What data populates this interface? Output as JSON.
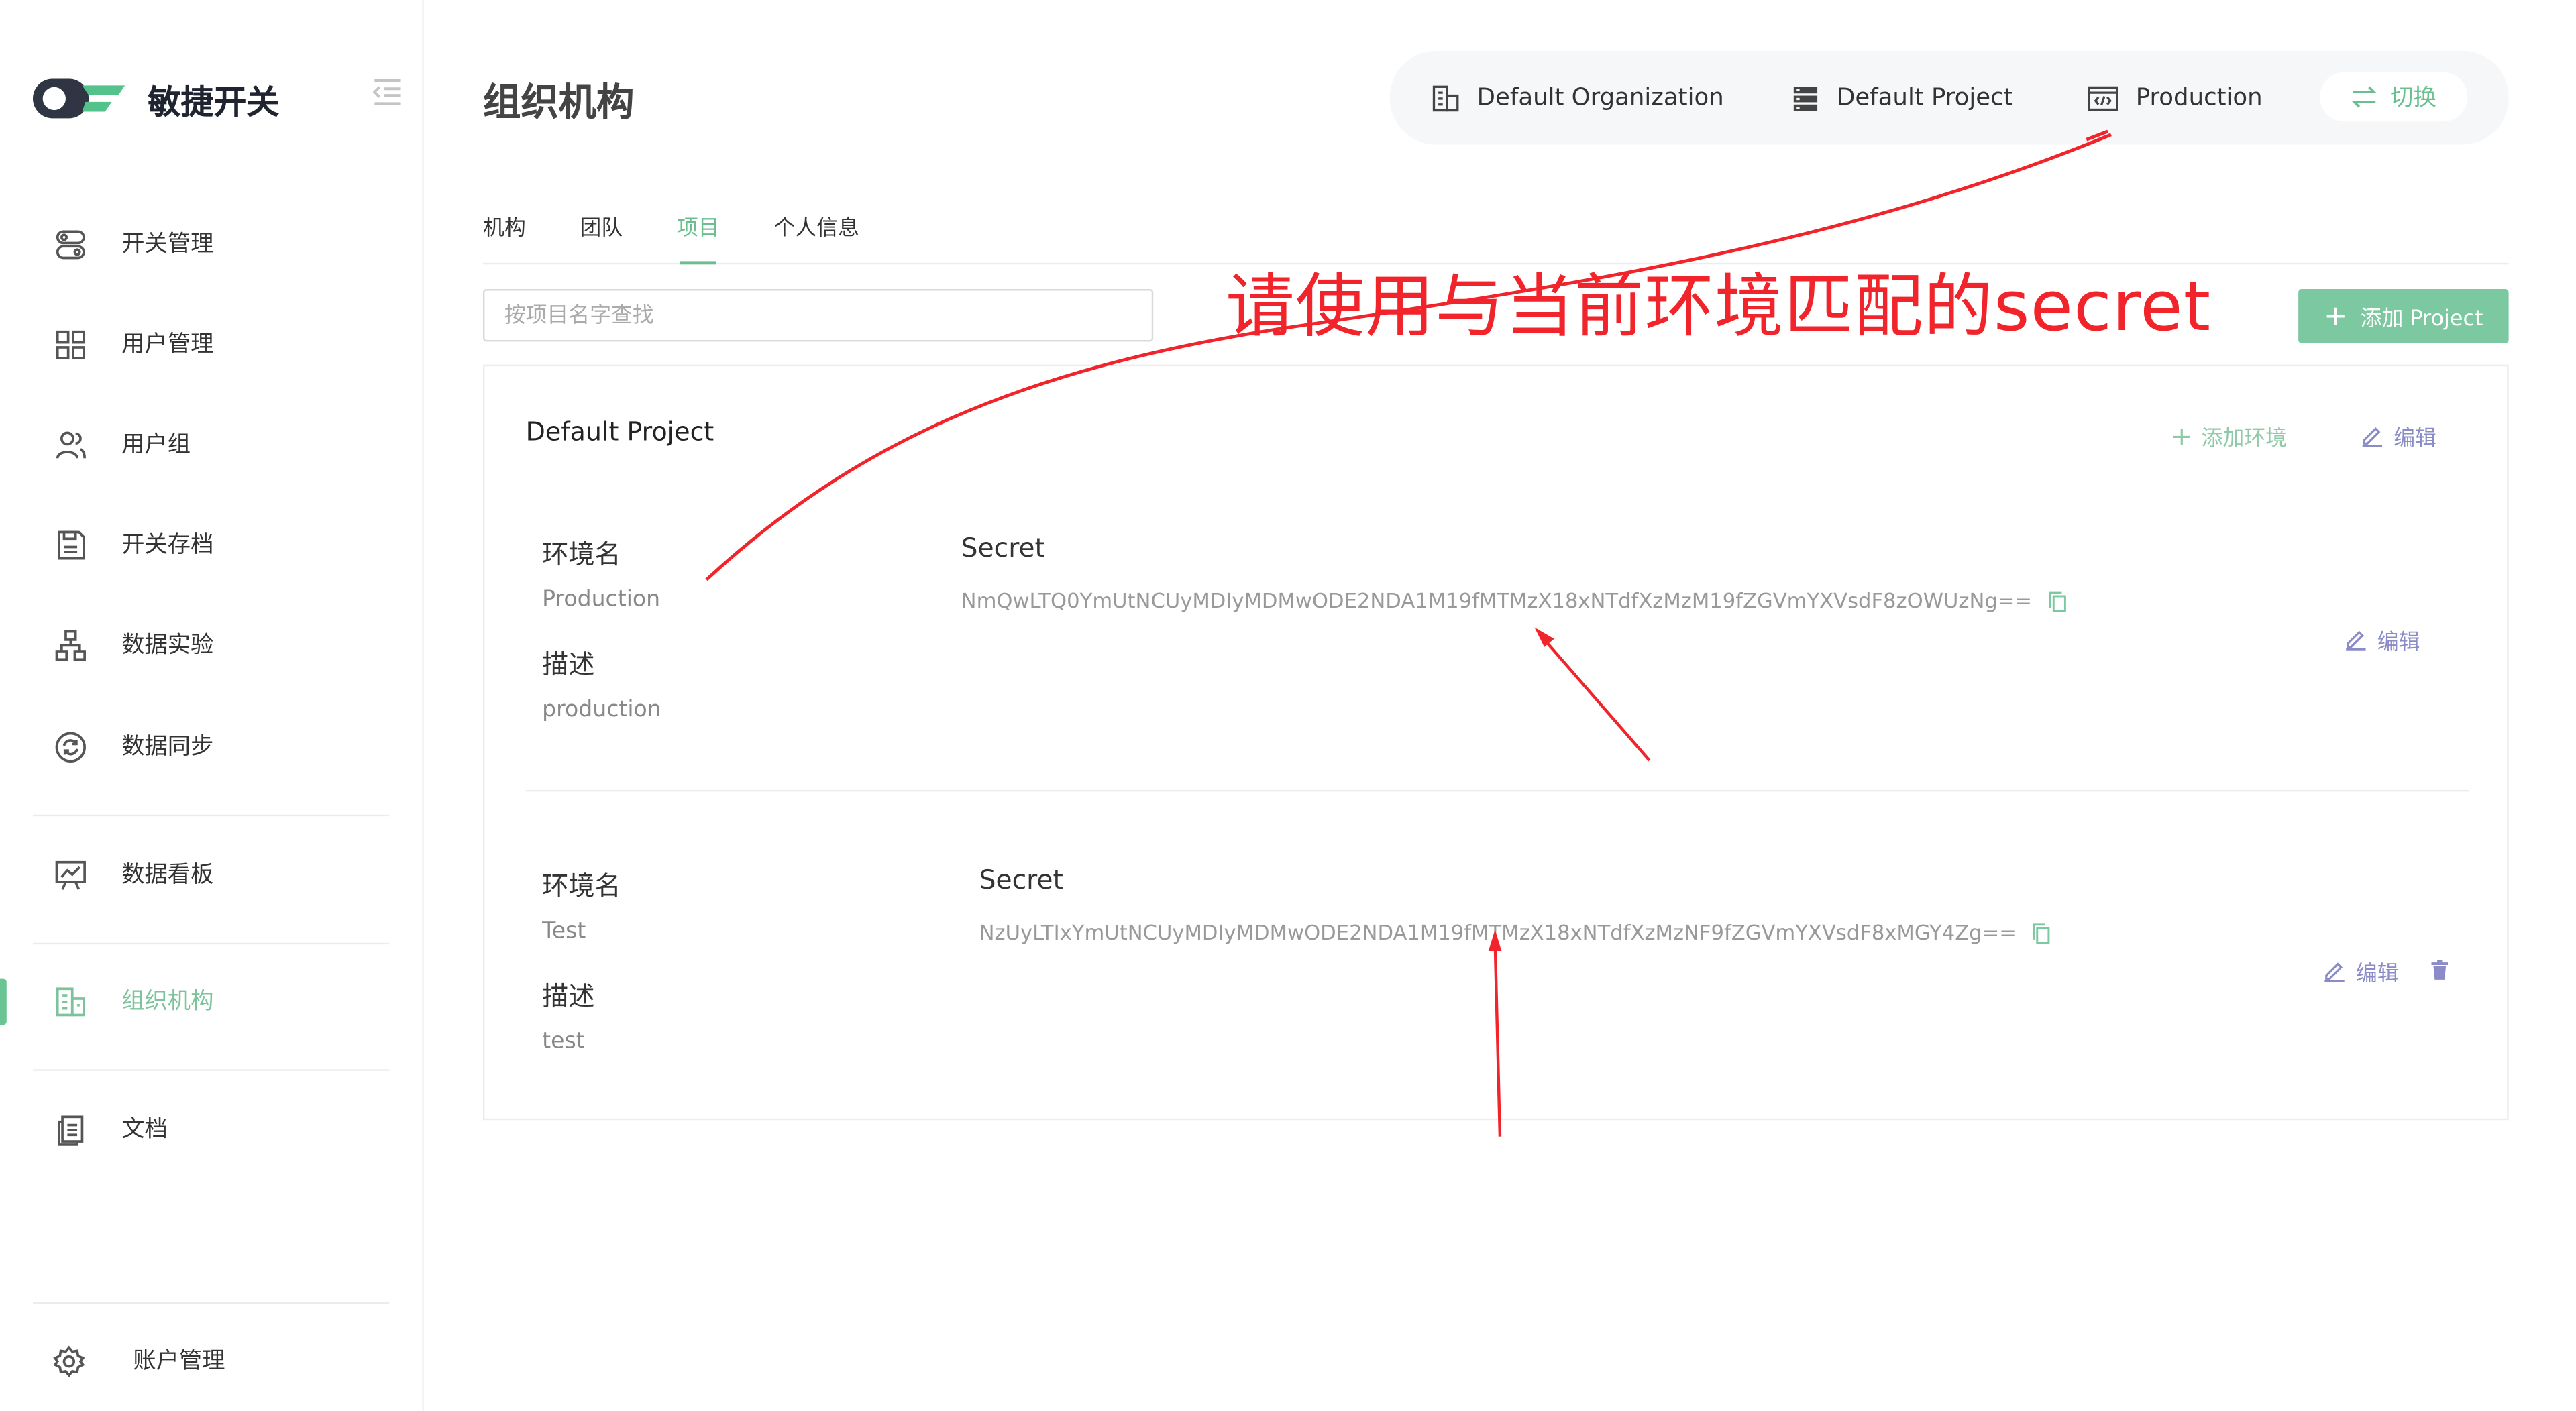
{
  "app": {
    "name": "敏捷开关"
  },
  "sidebar": {
    "items": [
      {
        "label": "开关管理",
        "icon": "toggle-icon"
      },
      {
        "label": "用户管理",
        "icon": "grid-icon"
      },
      {
        "label": "用户组",
        "icon": "users-icon"
      },
      {
        "label": "开关存档",
        "icon": "archive-icon"
      },
      {
        "label": "数据实验",
        "icon": "hierarchy-icon"
      },
      {
        "label": "数据同步",
        "icon": "sync-icon"
      },
      {
        "label": "数据看板",
        "icon": "dashboard-icon"
      },
      {
        "label": "组织机构",
        "icon": "building-icon",
        "active": true
      },
      {
        "label": "文档",
        "icon": "document-icon"
      }
    ],
    "account": {
      "label": "账户管理",
      "icon": "gear-icon"
    }
  },
  "header": {
    "title": "组织机构",
    "context": {
      "organization": "Default Organization",
      "project": "Default Project",
      "environment": "Production",
      "switch_label": "切换"
    }
  },
  "tabs": [
    {
      "label": "机构"
    },
    {
      "label": "团队"
    },
    {
      "label": "项目",
      "active": true
    },
    {
      "label": "个人信息"
    }
  ],
  "search": {
    "placeholder": "按项目名字查找"
  },
  "add_project_label": "添加 Project",
  "project": {
    "name": "Default Project",
    "add_env_label": "添加环境",
    "edit_label": "编辑",
    "environments": [
      {
        "name_label": "环境名",
        "name": "Production",
        "desc_label": "描述",
        "description": "production",
        "secret_label": "Secret",
        "secret": "NmQwLTQ0YmUtNCUyMDIyMDMwODE2NDA1M19fMTMzX18xNTdfXzMzM19fZGVmYXVsdF8zOWUzNg==",
        "edit_label": "编辑"
      },
      {
        "name_label": "环境名",
        "name": "Test",
        "desc_label": "描述",
        "description": "test",
        "secret_label": "Secret",
        "secret": "NzUyLTIxYmUtNCUyMDIyMDMwODE2NDA1M19fMTMzX18xNTdfXzMzNF9fZGVmYXVsdF8xMGY4Zg==",
        "edit_label": "编辑"
      }
    ]
  },
  "annotation": {
    "text": "请使用与当前环境匹配的secret",
    "color": "#f0242a"
  },
  "colors": {
    "accent": "#6bbf8f",
    "link_purple": "#8a8bc7"
  }
}
